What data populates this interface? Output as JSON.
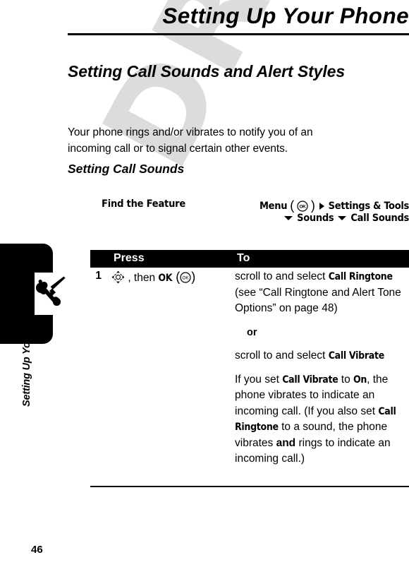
{
  "page": {
    "number": "46",
    "watermark": "DRAFT",
    "watermark_color": "#dcdcdc",
    "running_head": "Setting Up Your Phone",
    "chapter_title": "Setting Up Your Phone",
    "tab_icon": "wrench-screwdriver-icon"
  },
  "content": {
    "heading1": "Setting Call Sounds and Alert Styles",
    "intro": "Your phone rings and/or vibrates to notify you of an incoming call or to signal certain other events.",
    "heading2": "Setting Call Sounds"
  },
  "find_the_feature": {
    "label": "Find the Feature",
    "menu_label": "Menu",
    "ok_icon": "ok-key-icon",
    "arrow_right_icon": "triangle-right-icon",
    "arrow_down_icon": "triangle-down-icon",
    "path_line1": "Settings & Tools",
    "path_line2_item1": "Sounds",
    "path_line2_item2": "Call Sounds"
  },
  "table": {
    "columns": [
      "Press",
      "To"
    ],
    "rows": [
      {
        "step": "1",
        "press_nav_icon": "navigation-key-icon",
        "press_text_before": ", then ",
        "press_key": "OK",
        "press_ok_icon": "ok-key-icon",
        "to_paragraphs": [
          {
            "type": "text",
            "parts": [
              {
                "t": "scroll to and select ",
                "style": "normal"
              },
              {
                "t": "Call Ringtone",
                "style": "ui"
              },
              {
                "t": " (see “Call Ringtone and Alert Tone Options” on page 48)",
                "style": "normal"
              }
            ]
          },
          {
            "type": "or",
            "parts": [
              {
                "t": "or",
                "style": "bold"
              }
            ]
          },
          {
            "type": "text",
            "parts": [
              {
                "t": "scroll to and select ",
                "style": "normal"
              },
              {
                "t": "Call Vibrate",
                "style": "ui"
              }
            ]
          },
          {
            "type": "text",
            "parts": [
              {
                "t": "If you set ",
                "style": "normal"
              },
              {
                "t": "Call Vibrate",
                "style": "ui"
              },
              {
                "t": " to ",
                "style": "normal"
              },
              {
                "t": "On",
                "style": "ui"
              },
              {
                "t": ", the phone vibrates to indicate an incoming call. (If you also set ",
                "style": "normal"
              },
              {
                "t": "Call Ringtone",
                "style": "ui"
              },
              {
                "t": " to a sound, the phone vibrates ",
                "style": "normal"
              },
              {
                "t": "and",
                "style": "bold"
              },
              {
                "t": " rings to indicate an incoming call.)",
                "style": "normal"
              }
            ]
          }
        ]
      }
    ]
  }
}
